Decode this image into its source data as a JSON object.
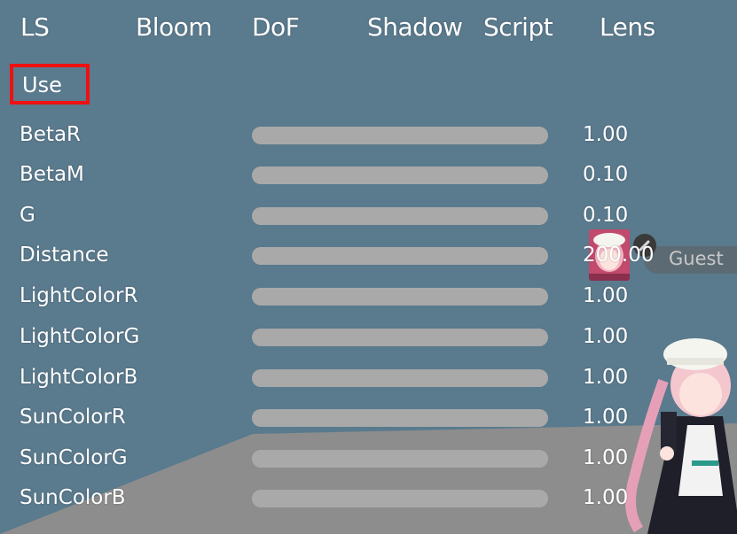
{
  "tabs": [
    "LS",
    "Bloom",
    "DoF",
    "Shadow",
    "Script",
    "Lens"
  ],
  "use_label": "Use",
  "params": [
    {
      "label": "BetaR",
      "value": "1.00"
    },
    {
      "label": "BetaM",
      "value": "0.10"
    },
    {
      "label": "G",
      "value": "0.10"
    },
    {
      "label": "Distance",
      "value": "200.00"
    },
    {
      "label": "LightColorR",
      "value": "1.00"
    },
    {
      "label": "LightColorG",
      "value": "1.00"
    },
    {
      "label": "LightColorB",
      "value": "1.00"
    },
    {
      "label": "SunColorR",
      "value": "1.00"
    },
    {
      "label": "SunColorG",
      "value": "1.00"
    },
    {
      "label": "SunColorB",
      "value": "1.00"
    }
  ],
  "overlay": {
    "guest_label": "Guest"
  },
  "colors": {
    "background": "#5a7a8d",
    "floor": "#8d8d8d",
    "slider_track": "#a9a9a9",
    "highlight": "#ee1111"
  },
  "icons": {
    "user_avatar": "avatar-thumbnail",
    "character": "anime-character-figure"
  }
}
